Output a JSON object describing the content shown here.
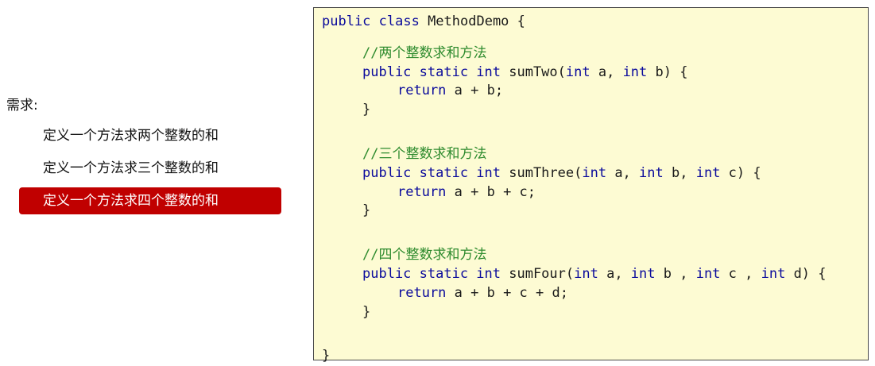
{
  "requirements": {
    "title": "需求:",
    "items": [
      {
        "label": "定义一个方法求两个整数的和",
        "active": false
      },
      {
        "label": "定义一个方法求三个整数的和",
        "active": false
      },
      {
        "label": "定义一个方法求四个整数的和",
        "active": true
      }
    ]
  },
  "code": {
    "class_decl": {
      "kw": "public class",
      "rest": " MethodDemo {"
    },
    "methods": [
      {
        "comment": "//两个整数求和方法",
        "modifiers": "public static int",
        "sig_name": " sumTwo(",
        "p1_kw": "int",
        "p1": " a, ",
        "p2_kw": "int",
        "p2": " b) {",
        "ret_kw": "return",
        "ret": " a + b;",
        "close": "}"
      },
      {
        "comment": "//三个整数求和方法",
        "modifiers": "public static int",
        "sig_name": " sumThree(",
        "p1_kw": "int",
        "p1": " a, ",
        "p2_kw": "int",
        "p2": " b, ",
        "p3_kw": "int",
        "p3": " c) {",
        "ret_kw": "return",
        "ret": " a + b + c;",
        "close": "}"
      },
      {
        "comment": "//四个整数求和方法",
        "modifiers": "public static int",
        "sig_name": " sumFour(",
        "p1_kw": "int",
        "p1": " a, ",
        "p2_kw": "int",
        "p2": " b , ",
        "p3_kw": "int",
        "p3": " c , ",
        "p4_kw": "int",
        "p4": " d) {",
        "ret_kw": "return",
        "ret": " a + b + c + d;",
        "close": "}"
      }
    ],
    "class_close": "}"
  },
  "colors": {
    "accent": "#c00000",
    "code_background": "#fdfbd3",
    "keyword": "#0b0b9c",
    "comment": "#2e8b2e"
  }
}
